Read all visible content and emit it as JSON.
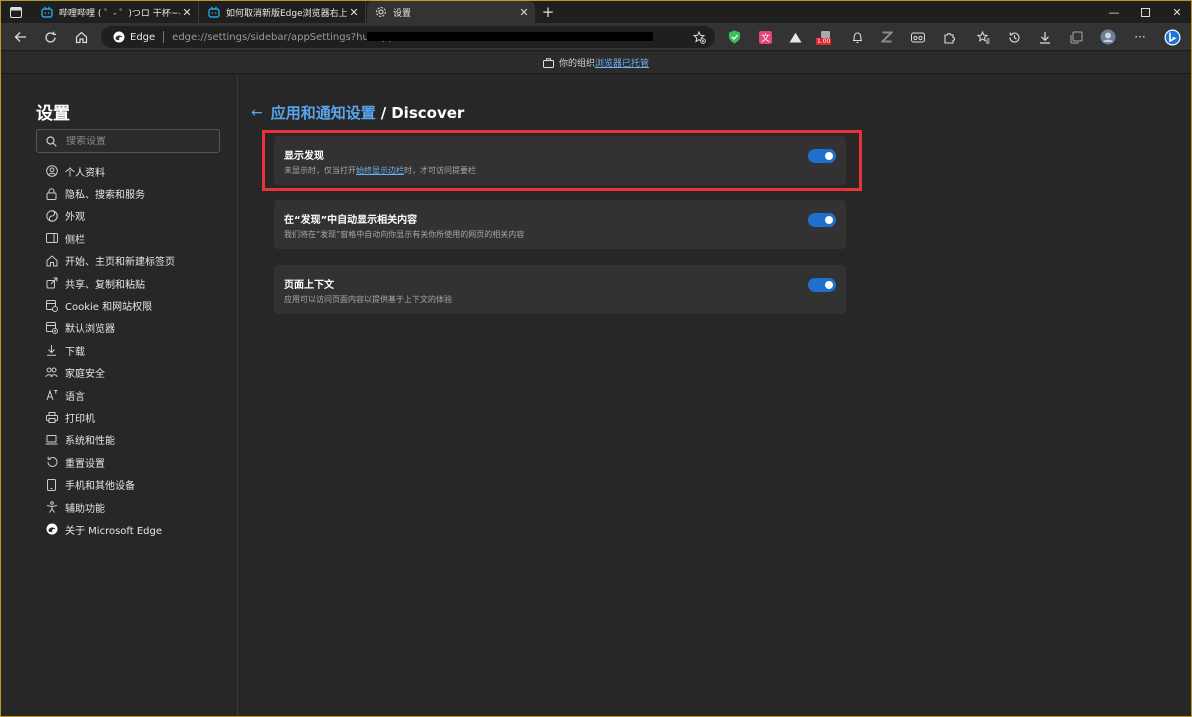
{
  "tabs": [
    {
      "title": "哔哩哔哩 ( ゜- ゜)つロ 干杯~-bilib",
      "favicon": "bilibili-icon",
      "active": false
    },
    {
      "title": "如何取消新版Edge浏览器右上角",
      "favicon": "bilibili-icon",
      "active": false
    },
    {
      "title": "设置",
      "favicon": "gear-icon",
      "active": true
    }
  ],
  "toolbar": {
    "edge_label": "Edge",
    "url": "edge://settings/sidebar/appSettings?hubApp=",
    "badge_count": "1.00"
  },
  "banner": {
    "prefix": "你的组织",
    "link": "浏览器已托管"
  },
  "sidebar": {
    "title": "设置",
    "search_placeholder": "搜索设置",
    "items": [
      {
        "label": "个人资料",
        "icon": "profile-icon"
      },
      {
        "label": "隐私、搜索和服务",
        "icon": "lock-icon"
      },
      {
        "label": "外观",
        "icon": "appearance-icon"
      },
      {
        "label": "侧栏",
        "icon": "sidebar-icon"
      },
      {
        "label": "开始、主页和新建标签页",
        "icon": "home-icon"
      },
      {
        "label": "共享、复制和粘贴",
        "icon": "share-icon"
      },
      {
        "label": "Cookie 和网站权限",
        "icon": "cookie-icon"
      },
      {
        "label": "默认浏览器",
        "icon": "default-browser-icon"
      },
      {
        "label": "下载",
        "icon": "download-icon"
      },
      {
        "label": "家庭安全",
        "icon": "family-icon"
      },
      {
        "label": "语言",
        "icon": "language-icon"
      },
      {
        "label": "打印机",
        "icon": "printer-icon"
      },
      {
        "label": "系统和性能",
        "icon": "laptop-icon"
      },
      {
        "label": "重置设置",
        "icon": "reset-icon"
      },
      {
        "label": "手机和其他设备",
        "icon": "phone-icon"
      },
      {
        "label": "辅助功能",
        "icon": "accessibility-icon"
      },
      {
        "label": "关于 Microsoft Edge",
        "icon": "edge-icon"
      }
    ]
  },
  "main": {
    "breadcrumb_parent": "应用和通知设置",
    "breadcrumb_current": "Discover",
    "settings": [
      {
        "title": "显示发现",
        "desc_before": "未显示时，仅当打开",
        "desc_link": "始终显示边栏",
        "desc_after": "时，才可访问提要栏",
        "enabled": true
      },
      {
        "title": "在“发现”中自动显示相关内容",
        "desc_before": "我们将在“发现”窗格中自动向你显示有关你所使用的网页的相关内容",
        "desc_link": "",
        "desc_after": "",
        "enabled": true
      },
      {
        "title": "页面上下文",
        "desc_before": "应用可以访问页面内容以提供基于上下文的体验",
        "desc_link": "",
        "desc_after": "",
        "enabled": true
      }
    ]
  },
  "colors": {
    "accent": "#1f6fcf",
    "link": "#5aa6ee",
    "highlight": "#e8333b"
  }
}
